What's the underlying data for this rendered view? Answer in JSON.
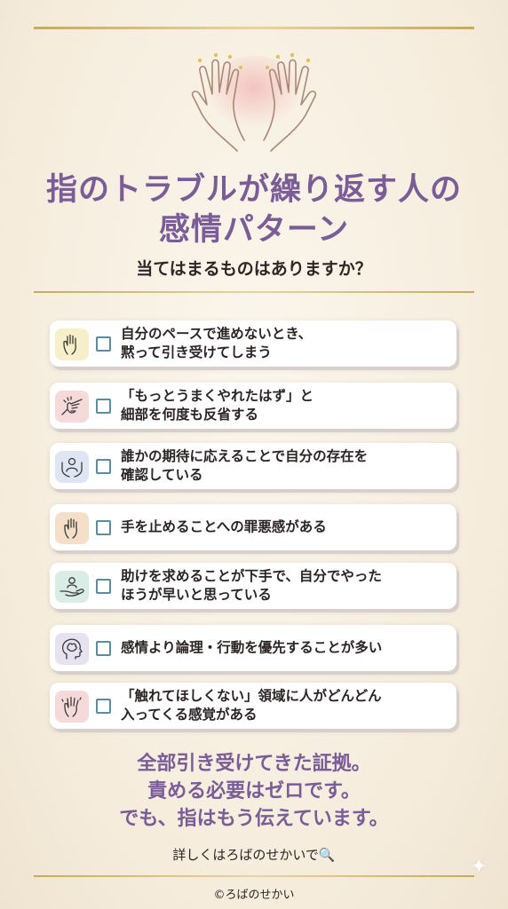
{
  "title_line1": "指のトラブルが繰り返す人の",
  "title_line2": "感情パターン",
  "subtitle": "当てはまるものはありますか？",
  "items": [
    {
      "icon": "raised-hand-icon",
      "icon_bg": "#f6efc9",
      "text": "自分のペースで進めないとき、\n黙って引き受けてしまう"
    },
    {
      "icon": "pointing-hand-icon",
      "icon_bg": "#f6dada",
      "text": "「もっとうまくやれたはず」と\n細部を何度も反省する"
    },
    {
      "icon": "person-in-hands-icon",
      "icon_bg": "#dde6f2",
      "text": "誰かの期待に応えることで自分の存在を\n確認している"
    },
    {
      "icon": "hand-icon",
      "icon_bg": "#f6dfc8",
      "text": "手を止めることへの罪悪感がある"
    },
    {
      "icon": "helping-hand-icon",
      "icon_bg": "#d9ece6",
      "text": "助けを求めることが下手で、自分でやった\nほうが早いと思っている"
    },
    {
      "icon": "brain-head-icon",
      "icon_bg": "#e6e2f0",
      "text": "感情より論理・行動を優先することが多い"
    },
    {
      "icon": "waving-hand-icon",
      "icon_bg": "#f6dada",
      "text": "「触れてほしくない」領域に人がどんどん\n入ってくる感覚がある"
    }
  ],
  "closing_line1": "全部引き受けてきた証拠。",
  "closing_line2": "責める必要はゼロです。",
  "closing_line3": "でも、指はもう伝えています。",
  "footer_link": "詳しくはろばのせかいで🔍",
  "copyright": "©ろばのせかい",
  "colors": {
    "title": "#7a5c97",
    "gold": "#c9a95c",
    "checkbox": "#5f8a9b"
  }
}
